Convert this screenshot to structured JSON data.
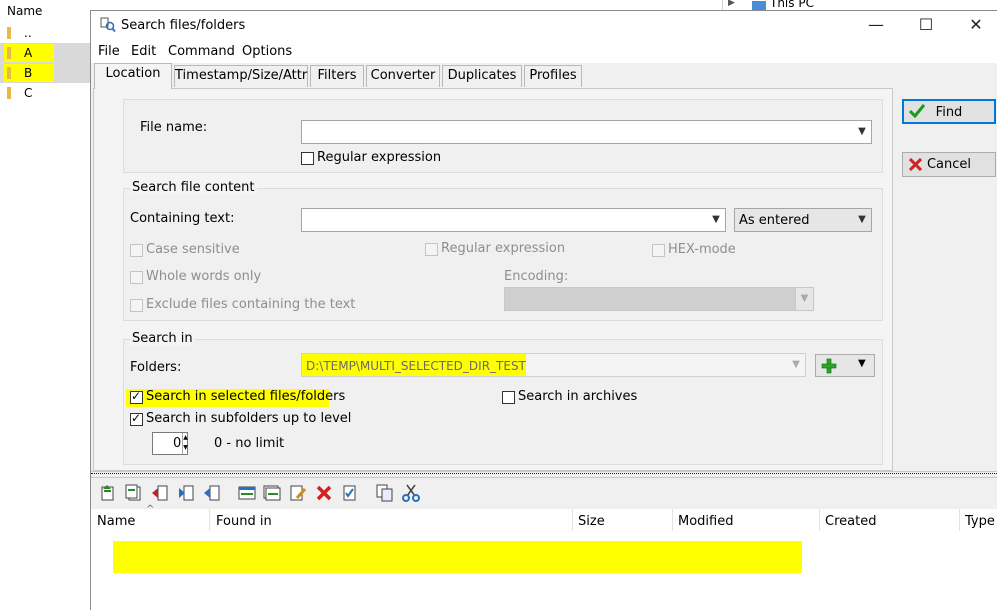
{
  "background_panel": {
    "header": "Name",
    "items": [
      {
        "label": ".."
      },
      {
        "label": "A"
      },
      {
        "label": "B"
      },
      {
        "label": "C"
      }
    ],
    "right_label": "This PC"
  },
  "window": {
    "title": "Search files/folders",
    "controls": {
      "minimize": "—",
      "maximize": "☐",
      "close": "✕"
    }
  },
  "menu": [
    "File",
    "Edit",
    "Command",
    "Options"
  ],
  "tabs": [
    "Location",
    "Timestamp/Size/Attr",
    "Filters",
    "Converter",
    "Duplicates",
    "Profiles"
  ],
  "location": {
    "file_name_label": "File name:",
    "file_name_value": "",
    "regex_label": "Regular expression",
    "content": {
      "group_title": "Search file content",
      "containing_label": "Containing text:",
      "containing_value": "",
      "mode_value": "As entered",
      "case_sensitive": "Case sensitive",
      "regular_expression": "Regular expression",
      "hex_mode": "HEX-mode",
      "whole_words": "Whole words only",
      "encoding_label": "Encoding:",
      "exclude": "Exclude files containing the text"
    },
    "search_in": {
      "group_title": "Search in",
      "folders_label": "Folders:",
      "folders_value": "D:\\TEMP\\MULTI_SELECTED_DIR_TEST",
      "selected_files": "Search in selected files/folders",
      "selected_files_checked": true,
      "archives": "Search in archives",
      "archives_checked": false,
      "subfolders": "Search in subfolders up to level",
      "subfolders_checked": true,
      "level_value": "0",
      "level_hint": "0 - no limit"
    }
  },
  "buttons": {
    "find": "Find",
    "cancel": "Cancel"
  },
  "results": {
    "columns": [
      "Name",
      "Found in",
      "Size",
      "Modified",
      "Created",
      "Type"
    ]
  },
  "colors": {
    "highlight": "#ffff00",
    "accent": "#0078d7",
    "find_check": "#1a9a1a",
    "cancel_x": "#d42020"
  }
}
